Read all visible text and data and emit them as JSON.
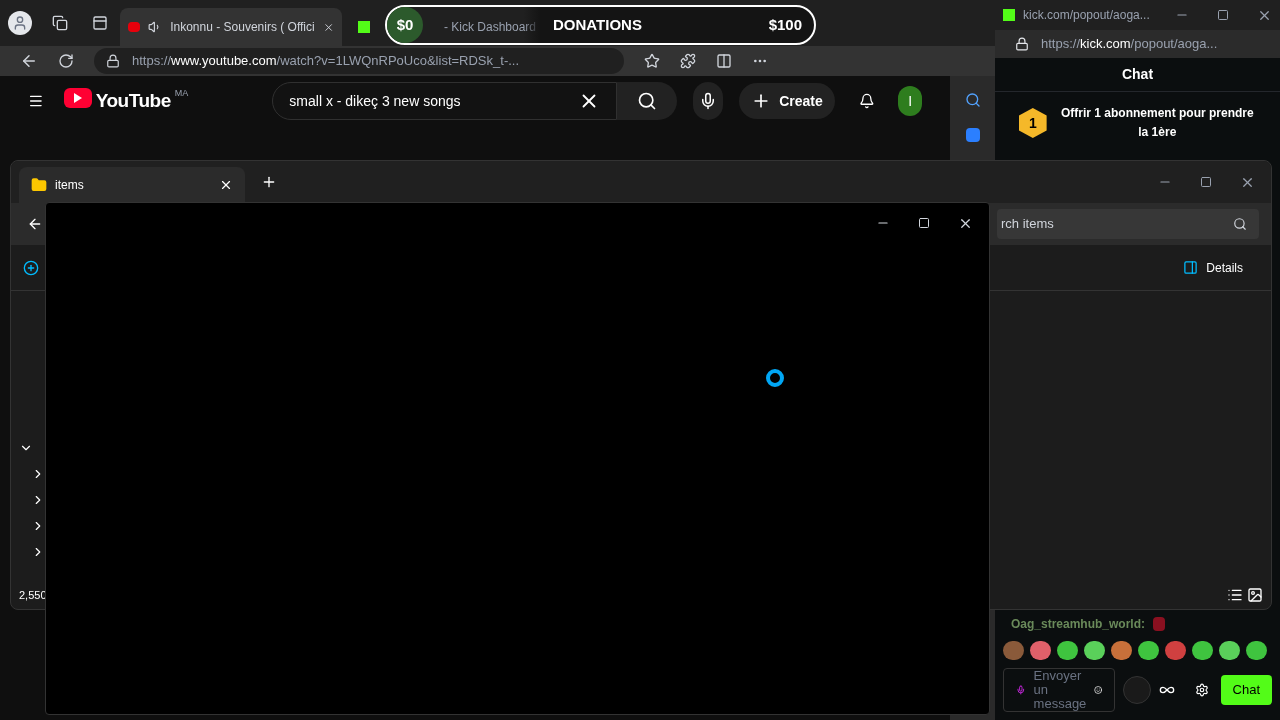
{
  "browser": {
    "tabs": [
      {
        "title": "Inkonnu - Souvenirs ( Offici",
        "selected": true
      },
      {
        "title": "- Kick Dashboard",
        "selected": false
      }
    ],
    "url": {
      "scheme": "https://",
      "host": "www.youtube.com",
      "path": "/watch?v=1LWQnRPoUco&list=RDSk_t-..."
    },
    "youtube": {
      "logo": "YouTube",
      "region": "MA",
      "search": "small x - dikeç 3 new songs",
      "create": "Create",
      "avatar": "I"
    }
  },
  "donations": {
    "current": "$0",
    "label": "DONATIONS",
    "goal": "$100"
  },
  "kick": {
    "title": "kick.com/popout/aoga...",
    "url": {
      "scheme": "https://",
      "host": "kick.com",
      "path": "/popout/aoga..."
    },
    "header": "Chat",
    "gift": {
      "badge": "1",
      "text": "Offrir 1 abonnement pour prendre la 1ère"
    },
    "username": "Oag_streamhub_world:",
    "input_placeholder": "Envoyer un message",
    "send": "Chat"
  },
  "explorer": {
    "tab": "items",
    "search_placeholder": "rch items",
    "details": "Details",
    "count": "2,550"
  },
  "overlay_window": {
    "loading": true
  }
}
